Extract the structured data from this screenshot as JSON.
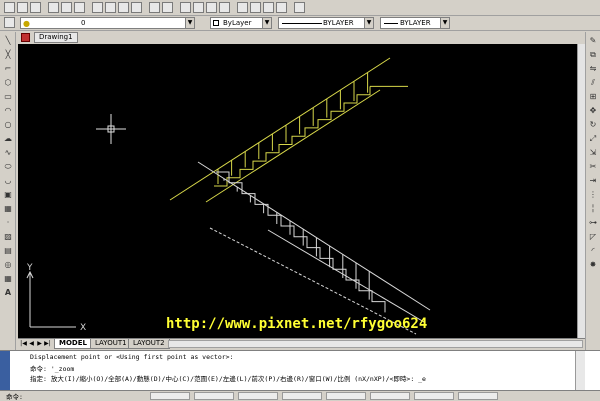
{
  "layers_bar": {
    "layer_value": "0",
    "color_value": "ByLayer",
    "linetype_value": "BYLAYER",
    "lineweight_value": "BYLAYER"
  },
  "document": {
    "tab_label": "Drawing1"
  },
  "layout_tabs": [
    "MODEL",
    "LAYOUT1",
    "LAYOUT2"
  ],
  "watermark": "http://www.pixnet.net/rfygoo624",
  "command": {
    "line1": "Displacement point or <Using first point as vector>:",
    "line2": "命令: '_zoom",
    "line3": "指定: 放大(I)/縮小(O)/全部(A)/動態(D)/中心(C)/范圍(E)/左邊(L)/前次(P)/右邊(R)/窗口(W)/比例 (nX/nXP)/<即時>: _e",
    "prompt": "命令:"
  },
  "ucs": {
    "x_label": "X",
    "y_label": "Y"
  },
  "colors": {
    "canvas": "#000000",
    "yellow_stair": "#d8d84a",
    "white_stair": "#d8d8d8",
    "crosshair": "#e0e0e0",
    "watermark": "#ffff33"
  }
}
